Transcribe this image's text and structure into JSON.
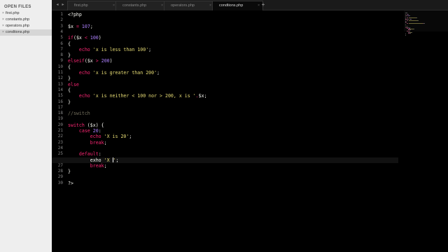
{
  "sidebar": {
    "header": "OPEN FILES",
    "close_glyph": "×",
    "files": [
      {
        "name": "first.php"
      },
      {
        "name": "constants.php"
      },
      {
        "name": "operators.php"
      },
      {
        "name": "condtions.php"
      }
    ]
  },
  "tabs": {
    "nav_left": "◂",
    "nav_right": "▸",
    "items": [
      {
        "label": "first.php",
        "close": "×"
      },
      {
        "label": "constants.php",
        "close": "×"
      },
      {
        "label": "operators.php",
        "close": "×"
      },
      {
        "label": "condtions.php",
        "close": "×"
      }
    ],
    "plus": "+"
  },
  "editor": {
    "active_line": 26,
    "line_numbers": [
      "1",
      "2",
      "3",
      "4",
      "5",
      "6",
      "7",
      "8",
      "9",
      "10",
      "11",
      "12",
      "13",
      "14",
      "15",
      "16",
      "17",
      "18",
      "19",
      "20",
      "21",
      "22",
      "23",
      "24",
      "25",
      "26",
      "27",
      "28",
      "29",
      "30"
    ],
    "lines": [
      [
        [
          "plain",
          "<?php"
        ]
      ],
      [],
      [
        [
          "var",
          "$x"
        ],
        [
          "plain",
          " "
        ],
        [
          "kw",
          "="
        ],
        [
          "plain",
          " "
        ],
        [
          "num",
          "107"
        ],
        [
          "plain",
          ";"
        ]
      ],
      [],
      [
        [
          "kw",
          "if"
        ],
        [
          "plain",
          "("
        ],
        [
          "var",
          "$x"
        ],
        [
          "plain",
          " "
        ],
        [
          "kw",
          "<"
        ],
        [
          "plain",
          " "
        ],
        [
          "num",
          "100"
        ],
        [
          "plain",
          ")"
        ]
      ],
      [
        [
          "plain",
          "{"
        ]
      ],
      [
        [
          "plain",
          "    "
        ],
        [
          "kw",
          "echo"
        ],
        [
          "plain",
          " "
        ],
        [
          "str",
          "'x is less than 100'"
        ],
        [
          "plain",
          ";"
        ]
      ],
      [
        [
          "plain",
          "}"
        ]
      ],
      [
        [
          "kw",
          "elseif"
        ],
        [
          "plain",
          "("
        ],
        [
          "var",
          "$x"
        ],
        [
          "plain",
          " "
        ],
        [
          "kw",
          ">"
        ],
        [
          "plain",
          " "
        ],
        [
          "num",
          "200"
        ],
        [
          "plain",
          ")"
        ]
      ],
      [
        [
          "plain",
          "{"
        ]
      ],
      [
        [
          "plain",
          "    "
        ],
        [
          "kw",
          "echo"
        ],
        [
          "plain",
          " "
        ],
        [
          "str",
          "'x is greater than 200'"
        ],
        [
          "plain",
          ";"
        ]
      ],
      [
        [
          "plain",
          "}"
        ]
      ],
      [
        [
          "kw",
          "else"
        ]
      ],
      [
        [
          "plain",
          "{"
        ]
      ],
      [
        [
          "plain",
          "    "
        ],
        [
          "kw",
          "echo"
        ],
        [
          "plain",
          " "
        ],
        [
          "str",
          "'x is neither < 100 nor > 200, x is '"
        ],
        [
          "kw",
          "."
        ],
        [
          "var",
          "$x"
        ],
        [
          "plain",
          ";"
        ]
      ],
      [
        [
          "plain",
          "}"
        ]
      ],
      [],
      [
        [
          "com",
          "//switch"
        ]
      ],
      [],
      [
        [
          "kw",
          "switch"
        ],
        [
          "plain",
          " ("
        ],
        [
          "var",
          "$x"
        ],
        [
          "plain",
          ") {"
        ]
      ],
      [
        [
          "plain",
          "    "
        ],
        [
          "kw",
          "case"
        ],
        [
          "plain",
          " "
        ],
        [
          "num",
          "20"
        ],
        [
          "plain",
          ":"
        ]
      ],
      [
        [
          "plain",
          "        "
        ],
        [
          "kw",
          "echo"
        ],
        [
          "plain",
          " "
        ],
        [
          "str",
          "'X is 20'"
        ],
        [
          "plain",
          ";"
        ]
      ],
      [
        [
          "plain",
          "        "
        ],
        [
          "kw",
          "break"
        ],
        [
          "plain",
          ";"
        ]
      ],
      [],
      [
        [
          "plain",
          "    "
        ],
        [
          "kw",
          "default"
        ],
        [
          "plain",
          ":"
        ]
      ],
      [
        [
          "plain",
          "        "
        ],
        [
          "plain",
          "exho"
        ],
        [
          "plain",
          " "
        ],
        [
          "str",
          "'X "
        ],
        [
          "cursor",
          ""
        ],
        [
          "str",
          "'"
        ],
        [
          "plain",
          ";"
        ]
      ],
      [
        [
          "plain",
          "        "
        ],
        [
          "kw",
          "break"
        ],
        [
          "plain",
          ";"
        ]
      ],
      [
        [
          "plain",
          "}"
        ]
      ],
      [],
      [
        [
          "plain",
          "?>"
        ]
      ]
    ]
  }
}
